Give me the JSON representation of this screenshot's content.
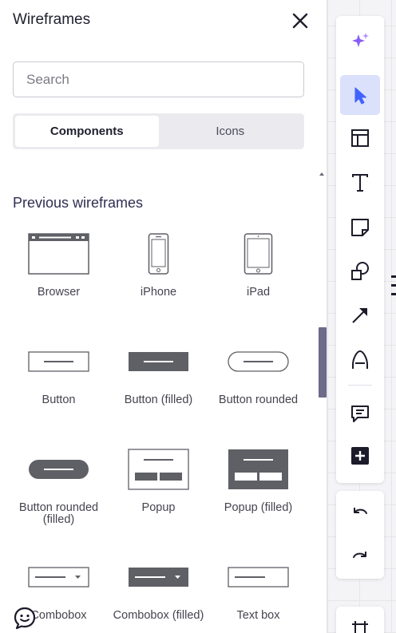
{
  "panel": {
    "title": "Wireframes",
    "search_placeholder": "Search",
    "tabs": [
      {
        "label": "Components",
        "active": true
      },
      {
        "label": "Icons",
        "active": false
      }
    ],
    "section_title": "Previous wireframes",
    "items": [
      {
        "label": "Browser",
        "icon": "browser-icon"
      },
      {
        "label": "iPhone",
        "icon": "iphone-icon"
      },
      {
        "label": "iPad",
        "icon": "ipad-icon"
      },
      {
        "label": "Button",
        "icon": "button-icon"
      },
      {
        "label": "Button (filled)",
        "icon": "button-filled-icon"
      },
      {
        "label": "Button rounded",
        "icon": "button-rounded-icon"
      },
      {
        "label": "Button rounded (filled)",
        "icon": "button-rounded-filled-icon"
      },
      {
        "label": "Popup",
        "icon": "popup-icon"
      },
      {
        "label": "Popup (filled)",
        "icon": "popup-filled-icon"
      },
      {
        "label": "Combobox",
        "icon": "combobox-icon"
      },
      {
        "label": "Combobox (filled)",
        "icon": "combobox-filled-icon"
      },
      {
        "label": "Text box",
        "icon": "text-box-icon"
      }
    ]
  },
  "toolbar": {
    "tools": [
      {
        "name": "ai-assist",
        "icon": "sparkles-icon"
      },
      {
        "name": "select",
        "icon": "cursor-arrow-icon",
        "active": true
      },
      {
        "name": "templates",
        "icon": "layout-icon"
      },
      {
        "name": "text",
        "icon": "text-icon"
      },
      {
        "name": "sticky-note",
        "icon": "sticky-note-icon"
      },
      {
        "name": "shapes",
        "icon": "shapes-icon"
      },
      {
        "name": "connection-line",
        "icon": "arrow-line-icon"
      },
      {
        "name": "pen",
        "icon": "pen-icon"
      },
      {
        "name": "comment",
        "icon": "comment-icon"
      },
      {
        "name": "add-more",
        "icon": "plus-square-icon"
      }
    ],
    "history": [
      {
        "name": "undo",
        "icon": "undo-icon"
      },
      {
        "name": "redo",
        "icon": "redo-icon"
      }
    ]
  },
  "colors": {
    "accent": "#4262ff",
    "active_tool_bg": "#dbe0fb",
    "sparkle": "#8a5cf6",
    "wireframe_fill": "#5f5f66",
    "scrollbar": "#6e6a8a"
  }
}
